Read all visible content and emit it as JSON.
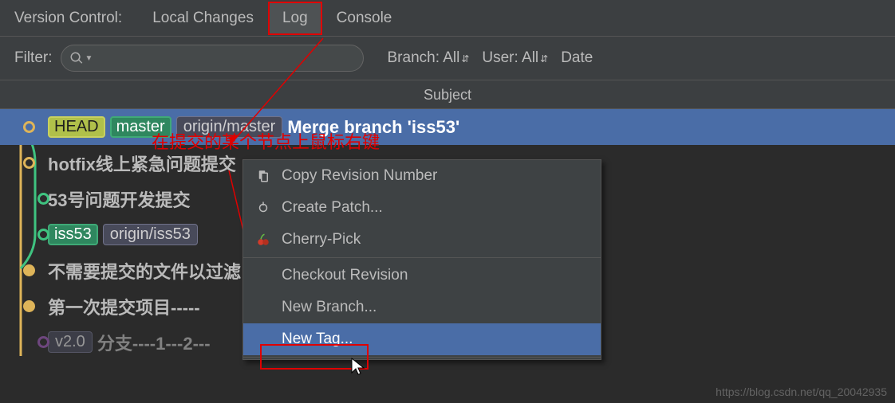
{
  "tabs": {
    "panel_label": "Version Control:",
    "local": "Local Changes",
    "log": "Log",
    "console": "Console"
  },
  "filter": {
    "label": "Filter:",
    "branch": "Branch: All",
    "user": "User: All",
    "date": "Date"
  },
  "header": {
    "subject": "Subject"
  },
  "annotation": "在提交的某个节点上鼠标右键",
  "commits": [
    {
      "tags_head": "HEAD",
      "tags_master": "master",
      "tags_remote": "origin/master",
      "text": "Merge branch 'iss53'"
    },
    {
      "text": "hotfix线上紧急问题提交"
    },
    {
      "text": "53号问题开发提交"
    },
    {
      "tags_iss53": "iss53",
      "tags_remote": "origin/iss53"
    },
    {
      "text": "不需要提交的文件以过滤"
    },
    {
      "text": "第一次提交项目-----"
    },
    {
      "tags_v20": "v2.0",
      "text": "分支----1---2---"
    }
  ],
  "menu": {
    "copy": "Copy Revision Number",
    "patch": "Create Patch...",
    "cherry": "Cherry-Pick",
    "checkout": "Checkout Revision",
    "branch": "New Branch...",
    "tag": "New Tag..."
  },
  "watermark": "https://blog.csdn.net/qq_20042935"
}
